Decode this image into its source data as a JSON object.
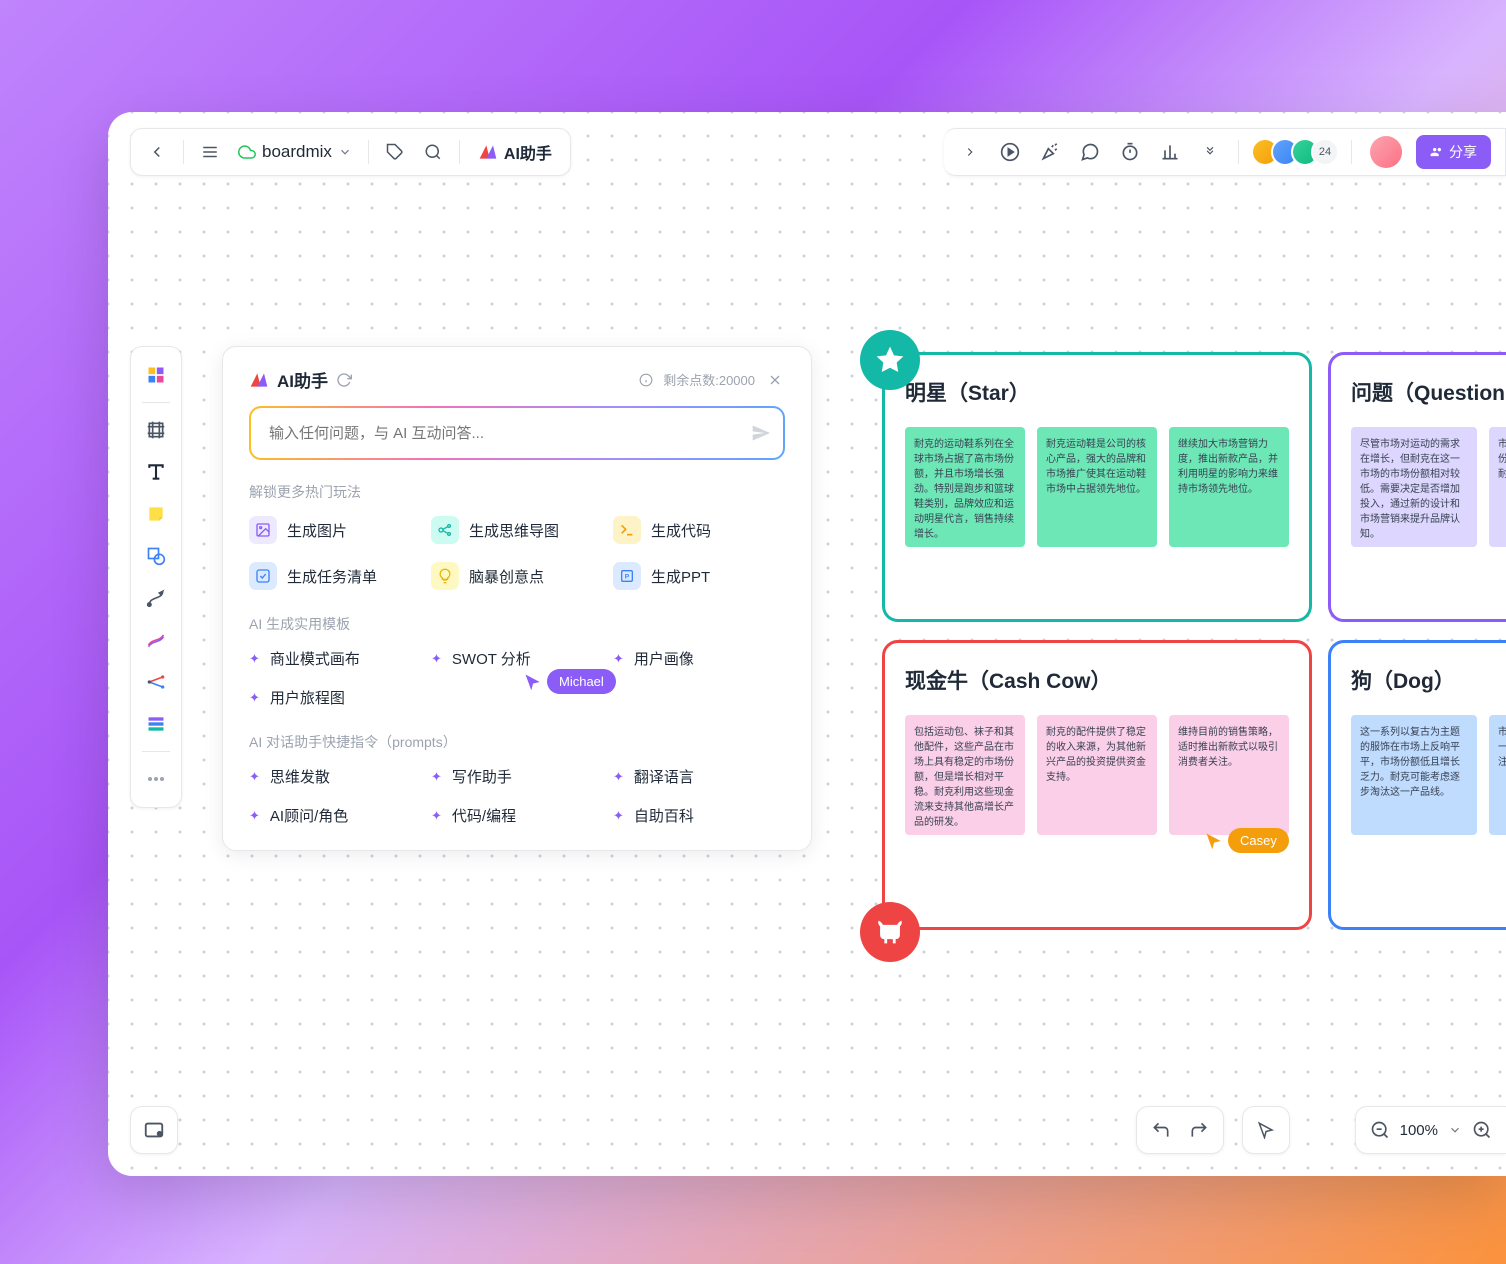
{
  "topbar": {
    "brand": "boardmix",
    "ai_assistant": "AI助手",
    "share": "分享",
    "avatar_extra": "24"
  },
  "bottom": {
    "zoom": "100%"
  },
  "ai_panel": {
    "title": "AI助手",
    "points_label": "剩余点数:20000",
    "input_placeholder": "输入任何问题，与 AI 互动问答...",
    "section1": "解锁更多热门玩法",
    "grid1": [
      "生成图片",
      "生成思维导图",
      "生成代码",
      "生成任务清单",
      "脑暴创意点",
      "生成PPT"
    ],
    "section2": "AI 生成实用模板",
    "grid2": [
      "商业模式画布",
      "SWOT 分析",
      "用户画像",
      "用户旅程图"
    ],
    "section3": "AI 对话助手快捷指令（prompts）",
    "grid3": [
      "思维发散",
      "写作助手",
      "翻译语言",
      "AI顾问/角色",
      "代码/编程",
      "自助百科"
    ]
  },
  "cursors": {
    "michael": "Michael",
    "casey": "Casey"
  },
  "quadrants": {
    "star": {
      "title": "明星（Star）",
      "notes": [
        "耐克的运动鞋系列在全球市场占据了高市场份额，并且市场增长强劲。特别是跑步和篮球鞋类别，品牌效应和运动明星代言，销售持续增长。",
        "耐克运动鞋是公司的核心产品，强大的品牌和市场推广使其在运动鞋市场中占据领先地位。",
        "继续加大市场营销力度，推出新款产品，并利用明星的影响力来维持市场领先地位。"
      ]
    },
    "question": {
      "title": "问题（Question Mark）",
      "notes": [
        "尽管市场对运动的需求在增长，但耐克在这一市场的市场份额相对较低。需要决定是否增加投入，通过新的设计和市场营销来提升品牌认知。",
        "市场在增长，但耐克的份额和其它对手相比，耐克需要提升品牌。"
      ]
    },
    "cash": {
      "title": "现金牛（Cash Cow）",
      "notes": [
        "包括运动包、袜子和其他配件，这些产品在市场上具有稳定的市场份额，但是增长相对平稳。耐克利用这些现金流来支持其他高增长产品的研发。",
        "耐克的配件提供了稳定的收入来源，为其他新兴产品的投资提供资金支持。",
        "维持目前的销售策略，适时推出新款式以吸引消费者关注。"
      ]
    },
    "dog": {
      "title": "狗（Dog）",
      "notes": [
        "这一系列以复古为主题的服饰在市场上反响平平，市场份额低且增长乏力。耐克可能考虑逐步淘汰这一产品线。",
        "市场在萎缩，份额的进一步丧失，耐克应该关注这一产品线。"
      ]
    }
  }
}
